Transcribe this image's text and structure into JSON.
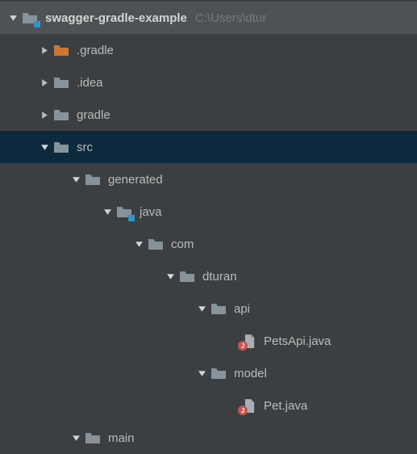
{
  "tree": {
    "root": {
      "name": "swagger-gradle-example",
      "path": "C:\\Users\\dtur",
      "gradle": ".gradle",
      "idea": ".idea",
      "gradleFolder": "gradle",
      "src": "src",
      "generated": "generated",
      "java": "java",
      "com": "com",
      "dturan": "dturan",
      "api": "api",
      "petsApi": "PetsApi.java",
      "model": "model",
      "pet": "Pet.java",
      "main": "main"
    }
  },
  "colors": {
    "folderGray": "#87939a",
    "folderOrange": "#cc7832",
    "fileGray": "#a7b0b7",
    "chevronDark": "#d4d4d4",
    "chevronLight": "#bbbbbb"
  }
}
